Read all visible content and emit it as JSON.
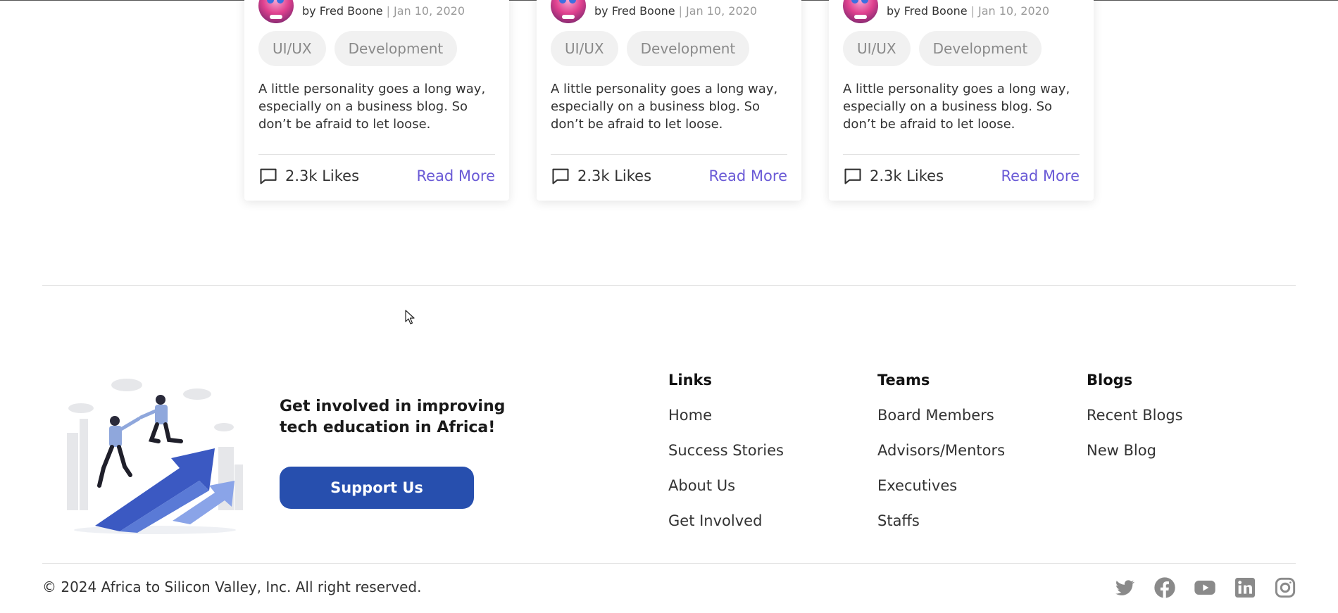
{
  "cards": [
    {
      "author": "by Fred Boone",
      "date": "Jan 10, 2020",
      "tags": [
        "UI/UX",
        "Development"
      ],
      "excerpt": "A little personality goes a long way, especially on a business blog. So don’t be afraid to let loose.",
      "likes": "2.3k Likes",
      "read_more": "Read More"
    },
    {
      "author": "by Fred Boone",
      "date": "Jan 10, 2020",
      "tags": [
        "UI/UX",
        "Development"
      ],
      "excerpt": "A little personality goes a long way, especially on a business blog. So don’t be afraid to let loose.",
      "likes": "2.3k Likes",
      "read_more": "Read More"
    },
    {
      "author": "by Fred Boone",
      "date": "Jan 10, 2020",
      "tags": [
        "UI/UX",
        "Development"
      ],
      "excerpt": "A little personality goes a long way, especially on a business blog. So don’t be afraid to let loose.",
      "likes": "2.3k Likes",
      "read_more": "Read More"
    }
  ],
  "footer": {
    "cta_title": "Get involved in improving tech education in Africa!",
    "support_button": "Support Us",
    "columns": {
      "links": {
        "heading": "Links",
        "items": [
          "Home",
          "Success Stories",
          "About Us",
          "Get Involved"
        ]
      },
      "teams": {
        "heading": "Teams",
        "items": [
          "Board Members",
          "Advisors/Mentors",
          "Executives",
          "Staffs"
        ]
      },
      "blogs": {
        "heading": "Blogs",
        "items": [
          "Recent Blogs",
          "New Blog"
        ]
      }
    },
    "copyright": "© 2024 Africa to Silicon Valley, Inc. All right reserved.",
    "socials": [
      "twitter-icon",
      "facebook-icon",
      "youtube-icon",
      "linkedin-icon",
      "instagram-icon"
    ]
  },
  "colors": {
    "primary_button": "#274fae",
    "read_more_link": "#6a5ad6",
    "tag_background": "#f1f1f1",
    "social_icon": "#8a8a8a"
  }
}
